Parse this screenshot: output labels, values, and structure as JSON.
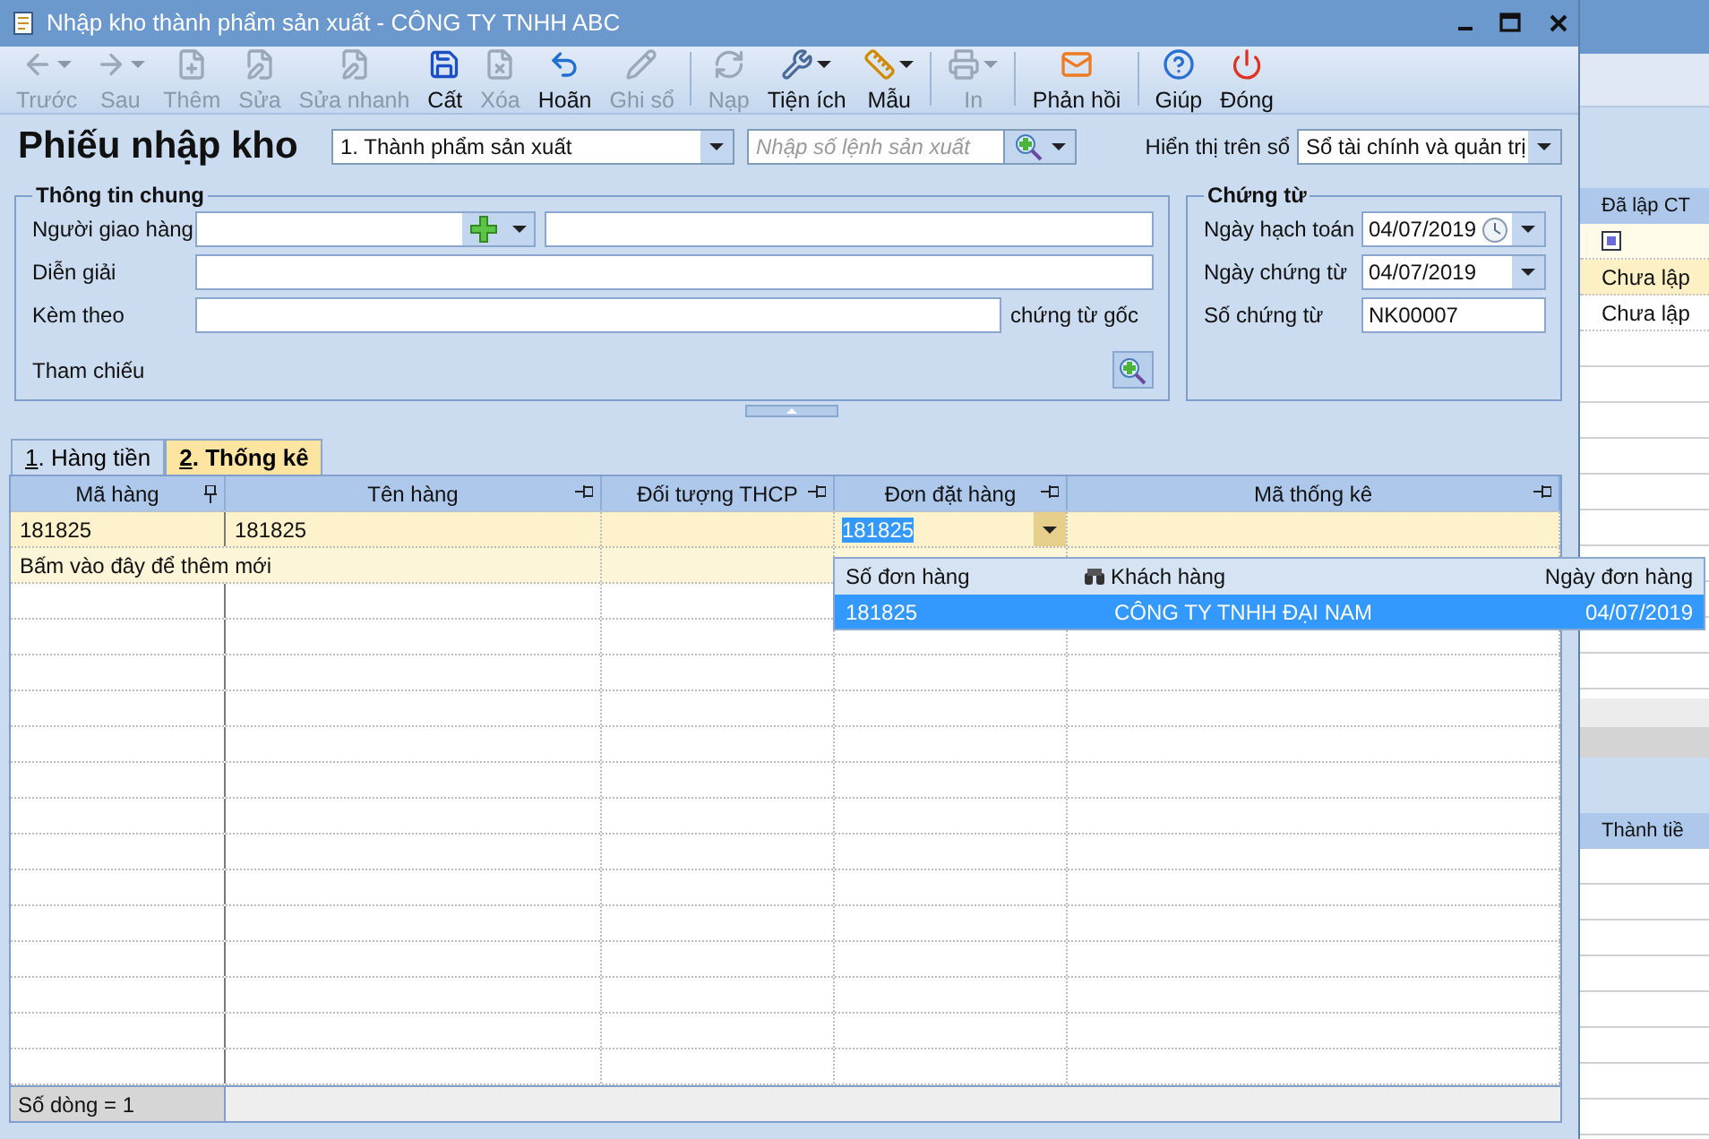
{
  "window": {
    "title": "Nhập kho thành phẩm sản xuất - CÔNG TY TNHH ABC"
  },
  "toolbar": {
    "groups": [
      [
        {
          "label": "Trước",
          "disabled": true,
          "has_menu": true
        },
        {
          "label": "Sau",
          "disabled": true,
          "has_menu": true
        },
        {
          "label": "Thêm",
          "disabled": true,
          "has_menu": false
        },
        {
          "label": "Sửa",
          "disabled": true,
          "has_menu": false
        },
        {
          "label": "Sửa nhanh",
          "disabled": true,
          "has_menu": false
        },
        {
          "label": "Cất",
          "disabled": false,
          "has_menu": false
        },
        {
          "label": "Xóa",
          "disabled": true,
          "has_menu": false
        },
        {
          "label": "Hoãn",
          "disabled": false,
          "has_menu": false
        },
        {
          "label": "Ghi sổ",
          "disabled": true,
          "has_menu": false
        }
      ],
      [
        {
          "label": "Nạp",
          "disabled": true,
          "has_menu": false
        },
        {
          "label": "Tiện ích",
          "disabled": false,
          "has_menu": true
        },
        {
          "label": "Mẫu",
          "disabled": false,
          "has_menu": true
        }
      ],
      [
        {
          "label": "In",
          "disabled": true,
          "has_menu": true
        }
      ],
      [
        {
          "label": "Phản hồi",
          "disabled": false,
          "has_menu": false
        }
      ],
      [
        {
          "label": "Giúp",
          "disabled": false,
          "has_menu": false
        },
        {
          "label": "Đóng",
          "disabled": false,
          "has_menu": false
        }
      ]
    ]
  },
  "header": {
    "title": "Phiếu nhập kho",
    "type_select": "1. Thành phẩm sản xuất",
    "order_search": {
      "placeholder": "Nhập số lệnh sản xuất"
    },
    "book_label": "Hiển thị trên sổ",
    "book_select": "Sổ tài chính và quản trị"
  },
  "general_info": {
    "title": "Thông tin chung",
    "deliverer_label": "Người giao hàng",
    "description_label": "Diễn giải",
    "attachment_label": "Kèm theo",
    "attachment_suffix": "chứng từ gốc",
    "reference_label": "Tham chiếu"
  },
  "voucher": {
    "title": "Chứng từ",
    "fields": [
      {
        "label": "Ngày hạch toán",
        "value": "04/07/2019",
        "kind": "datetime"
      },
      {
        "label": "Ngày chứng từ",
        "value": "04/07/2019",
        "kind": "date"
      },
      {
        "label": "Số chứng từ",
        "value": "NK00007",
        "kind": "text"
      }
    ]
  },
  "tabs": [
    {
      "label": "1. Hàng tiền",
      "selected": false
    },
    {
      "label": "2. Thống kê",
      "selected": true
    }
  ],
  "grid": {
    "columns": [
      {
        "label": "Mã hàng",
        "pinned": true
      },
      {
        "label": "Tên hàng",
        "pinned": false
      },
      {
        "label": "Đối tượng THCP",
        "pinned": false
      },
      {
        "label": "Đơn đặt hàng",
        "pinned": false
      },
      {
        "label": "Mã thống kê",
        "pinned": false
      }
    ],
    "rows": [
      {
        "selected": true,
        "cells": [
          {
            "text": "181825",
            "editing": false
          },
          {
            "text": "181825",
            "editing": false
          },
          {
            "editing": false
          },
          {
            "text": "181825",
            "editing": true
          },
          {
            "editing": false
          }
        ]
      }
    ],
    "new_row_hint": "Bấm vào đây để thêm mới",
    "footer": "Số dòng = 1"
  },
  "dropdown": {
    "columns": [
      {
        "label": "Số đơn hàng",
        "filterable": false
      },
      {
        "label": "Khách hàng",
        "filterable": true
      },
      {
        "label": "Ngày đơn hàng",
        "filterable": false
      }
    ],
    "rows": [
      {
        "cells": [
          "181825",
          "CÔNG TY TNHH ĐẠI NAM",
          "04/07/2019"
        ],
        "selected": true
      }
    ]
  },
  "background_grid": {
    "header": "Đã lập CT",
    "rows": [
      {
        "kind": "filter"
      },
      {
        "kind": "text",
        "text": "Chưa lập",
        "selected": true
      },
      {
        "kind": "text",
        "text": "Chưa lập",
        "selected": false
      }
    ],
    "second_header": "Thành tiề"
  }
}
